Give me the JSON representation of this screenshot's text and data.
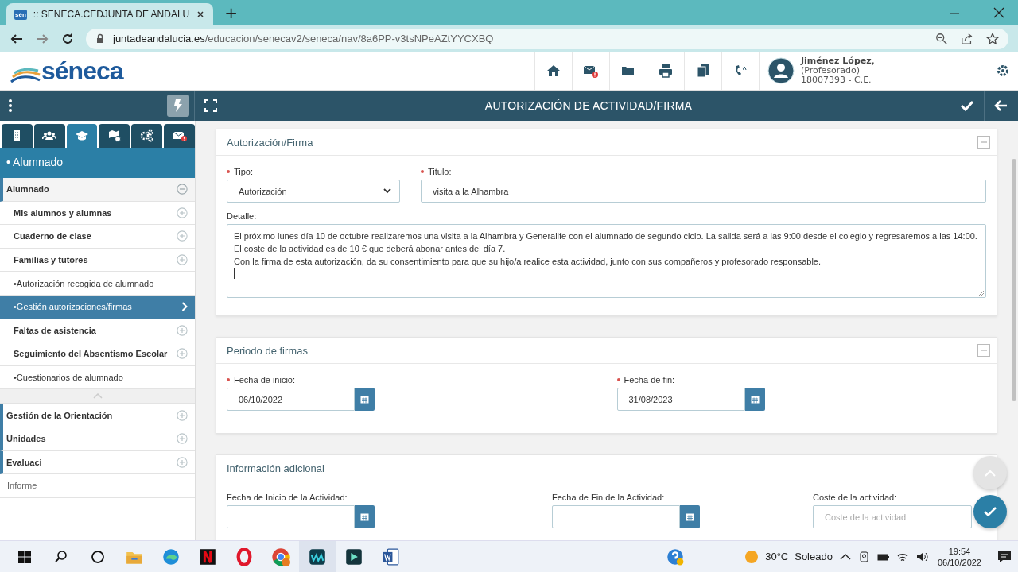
{
  "browser": {
    "favicon_text": "sén",
    "tab_title": ":: SENECA.CEDJUNTA DE ANDALU",
    "new_tab": "+",
    "url_domain": "juntadeandalucia.es",
    "url_path": "/educacion/senecav2/seneca/nav/8a6PP-v3tsNPeAZtYYCXBQ"
  },
  "header": {
    "logo_text": "séneca",
    "user": {
      "name": "Jiménez López,",
      "role": "(Profesorado)",
      "center": "18007393 - C.E."
    }
  },
  "title_bar": {
    "title": "AUTORIZACIÓN DE ACTIVIDAD/FIRMA"
  },
  "sidebar": {
    "tabs": [
      {
        "kind": "building",
        "selected": false
      },
      {
        "kind": "users",
        "selected": false
      },
      {
        "kind": "cap",
        "selected": true
      },
      {
        "kind": "map",
        "selected": false
      },
      {
        "kind": "gears",
        "selected": false
      },
      {
        "kind": "mail",
        "selected": false
      }
    ],
    "section_title": "• Alumnado",
    "menu": [
      {
        "label": "Alumnado",
        "kind": "group",
        "expanded": true,
        "children": [
          {
            "label": "Mis alumnos y alumnas",
            "kind": "folder",
            "selected": false
          },
          {
            "label": "Cuaderno de clase",
            "kind": "folder",
            "selected": false
          },
          {
            "label": "Familias y tutores",
            "kind": "folder",
            "selected": false
          },
          {
            "label": "•Autorización recogida de alumnado",
            "kind": "leaf",
            "selected": false
          },
          {
            "label": "•Gestión autorizaciones/firmas",
            "kind": "leaf",
            "selected": true
          },
          {
            "label": "Faltas de asistencia",
            "kind": "folder",
            "selected": false
          },
          {
            "label": "Seguimiento del Absentismo Escolar",
            "kind": "folder",
            "selected": false
          },
          {
            "label": "•Cuestionarios de alumnado",
            "kind": "leaf",
            "selected": false
          }
        ]
      },
      {
        "label": "Gestión de la Orientación",
        "kind": "group",
        "expanded": false
      },
      {
        "label": "Unidades",
        "kind": "group",
        "expanded": false
      },
      {
        "label": "Evaluaci",
        "kind": "group",
        "expanded": false
      },
      {
        "label": "Informe",
        "kind": "link"
      }
    ]
  },
  "cards": [
    {
      "title": "Autorización/Firma",
      "fields": [
        {
          "kind": "select",
          "label": "Tipo:",
          "required": true,
          "value": "Autorización"
        },
        {
          "kind": "text",
          "label": "Titulo:",
          "required": true,
          "value": "visita a la Alhambra"
        },
        {
          "kind": "textarea",
          "label": "Detalle:",
          "lines": [
            "El próximo lunes día 10 de octubre realizaremos una visita a la Alhambra y Generalife con el alumnado de segundo ciclo. La salida será a las 9:00 desde el colegio y regresaremos a las 14:00. El coste de la actividad es de 10 € que deberá abonar antes del día 7.",
            "Con la firma de esta autorización, da su consentimiento para que su hijo/a realice esta actividad, junto con sus compañeros y profesorado responsable."
          ]
        }
      ]
    },
    {
      "title": "Periodo de firmas",
      "fields": [
        {
          "kind": "date",
          "label": "Fecha de inicio:",
          "required": true,
          "value": "06/10/2022"
        },
        {
          "kind": "date",
          "label": "Fecha de fin:",
          "required": true,
          "value": "31/08/2023"
        }
      ]
    },
    {
      "title": "Información adicional",
      "fields": [
        {
          "kind": "date",
          "label": "Fecha de Inicio de la Actividad:"
        },
        {
          "kind": "date",
          "label": "Fecha de Fin de la Actividad:"
        },
        {
          "kind": "input",
          "label": "Coste de la actividad:",
          "placeholder": "Coste de la actividad"
        }
      ]
    }
  ],
  "taskbar": {
    "weather": "30°C",
    "condition": "Soleado",
    "time": "19:54",
    "date": "06/10/2022"
  }
}
